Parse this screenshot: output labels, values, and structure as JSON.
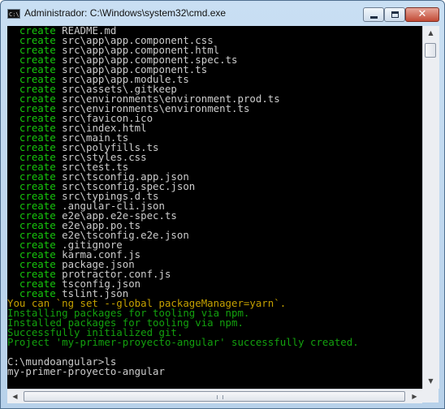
{
  "window": {
    "title": "Administrador: C:\\Windows\\system32\\cmd.exe",
    "icon_text": "C:\\",
    "minimize_icon": "minimize-icon",
    "maximize_icon": "maximize-icon",
    "close_symbol": "✕"
  },
  "console": {
    "colors": {
      "background": "#000000",
      "create": "#16c60c",
      "path": "#cccccc",
      "warning": "#c4a000",
      "success": "#13a10e"
    },
    "create_lines": [
      {
        "kw": "create",
        "path": "README.md"
      },
      {
        "kw": "create",
        "path": "src\\app\\app.component.css"
      },
      {
        "kw": "create",
        "path": "src\\app\\app.component.html"
      },
      {
        "kw": "create",
        "path": "src\\app\\app.component.spec.ts"
      },
      {
        "kw": "create",
        "path": "src\\app\\app.component.ts"
      },
      {
        "kw": "create",
        "path": "src\\app\\app.module.ts"
      },
      {
        "kw": "create",
        "path": "src\\assets\\.gitkeep"
      },
      {
        "kw": "create",
        "path": "src\\environments\\environment.prod.ts"
      },
      {
        "kw": "create",
        "path": "src\\environments\\environment.ts"
      },
      {
        "kw": "create",
        "path": "src\\favicon.ico"
      },
      {
        "kw": "create",
        "path": "src\\index.html"
      },
      {
        "kw": "create",
        "path": "src\\main.ts"
      },
      {
        "kw": "create",
        "path": "src\\polyfills.ts"
      },
      {
        "kw": "create",
        "path": "src\\styles.css"
      },
      {
        "kw": "create",
        "path": "src\\test.ts"
      },
      {
        "kw": "create",
        "path": "src\\tsconfig.app.json"
      },
      {
        "kw": "create",
        "path": "src\\tsconfig.spec.json"
      },
      {
        "kw": "create",
        "path": "src\\typings.d.ts"
      },
      {
        "kw": "create",
        "path": ".angular-cli.json"
      },
      {
        "kw": "create",
        "path": "e2e\\app.e2e-spec.ts"
      },
      {
        "kw": "create",
        "path": "e2e\\app.po.ts"
      },
      {
        "kw": "create",
        "path": "e2e\\tsconfig.e2e.json"
      },
      {
        "kw": "create",
        "path": ".gitignore"
      },
      {
        "kw": "create",
        "path": "karma.conf.js"
      },
      {
        "kw": "create",
        "path": "package.json"
      },
      {
        "kw": "create",
        "path": "protractor.conf.js"
      },
      {
        "kw": "create",
        "path": "tsconfig.json"
      },
      {
        "kw": "create",
        "path": "tslint.json"
      }
    ],
    "yarn_tip": "You can `ng set --global packageManager=yarn`.",
    "installing": "Installing packages for tooling via npm.",
    "installed": "Installed packages for tooling via npm.",
    "git_init": "Successfully initialized git.",
    "project_created": "Project 'my-primer-proyecto-angular' successfully created.",
    "prompt_command": "C:\\mundoangular>ls",
    "ls_output": "my-primer-proyecto-angular"
  },
  "scrollbars": {
    "up_arrow": "▲",
    "down_arrow": "▼",
    "left_arrow": "◀",
    "right_arrow": "▶"
  }
}
